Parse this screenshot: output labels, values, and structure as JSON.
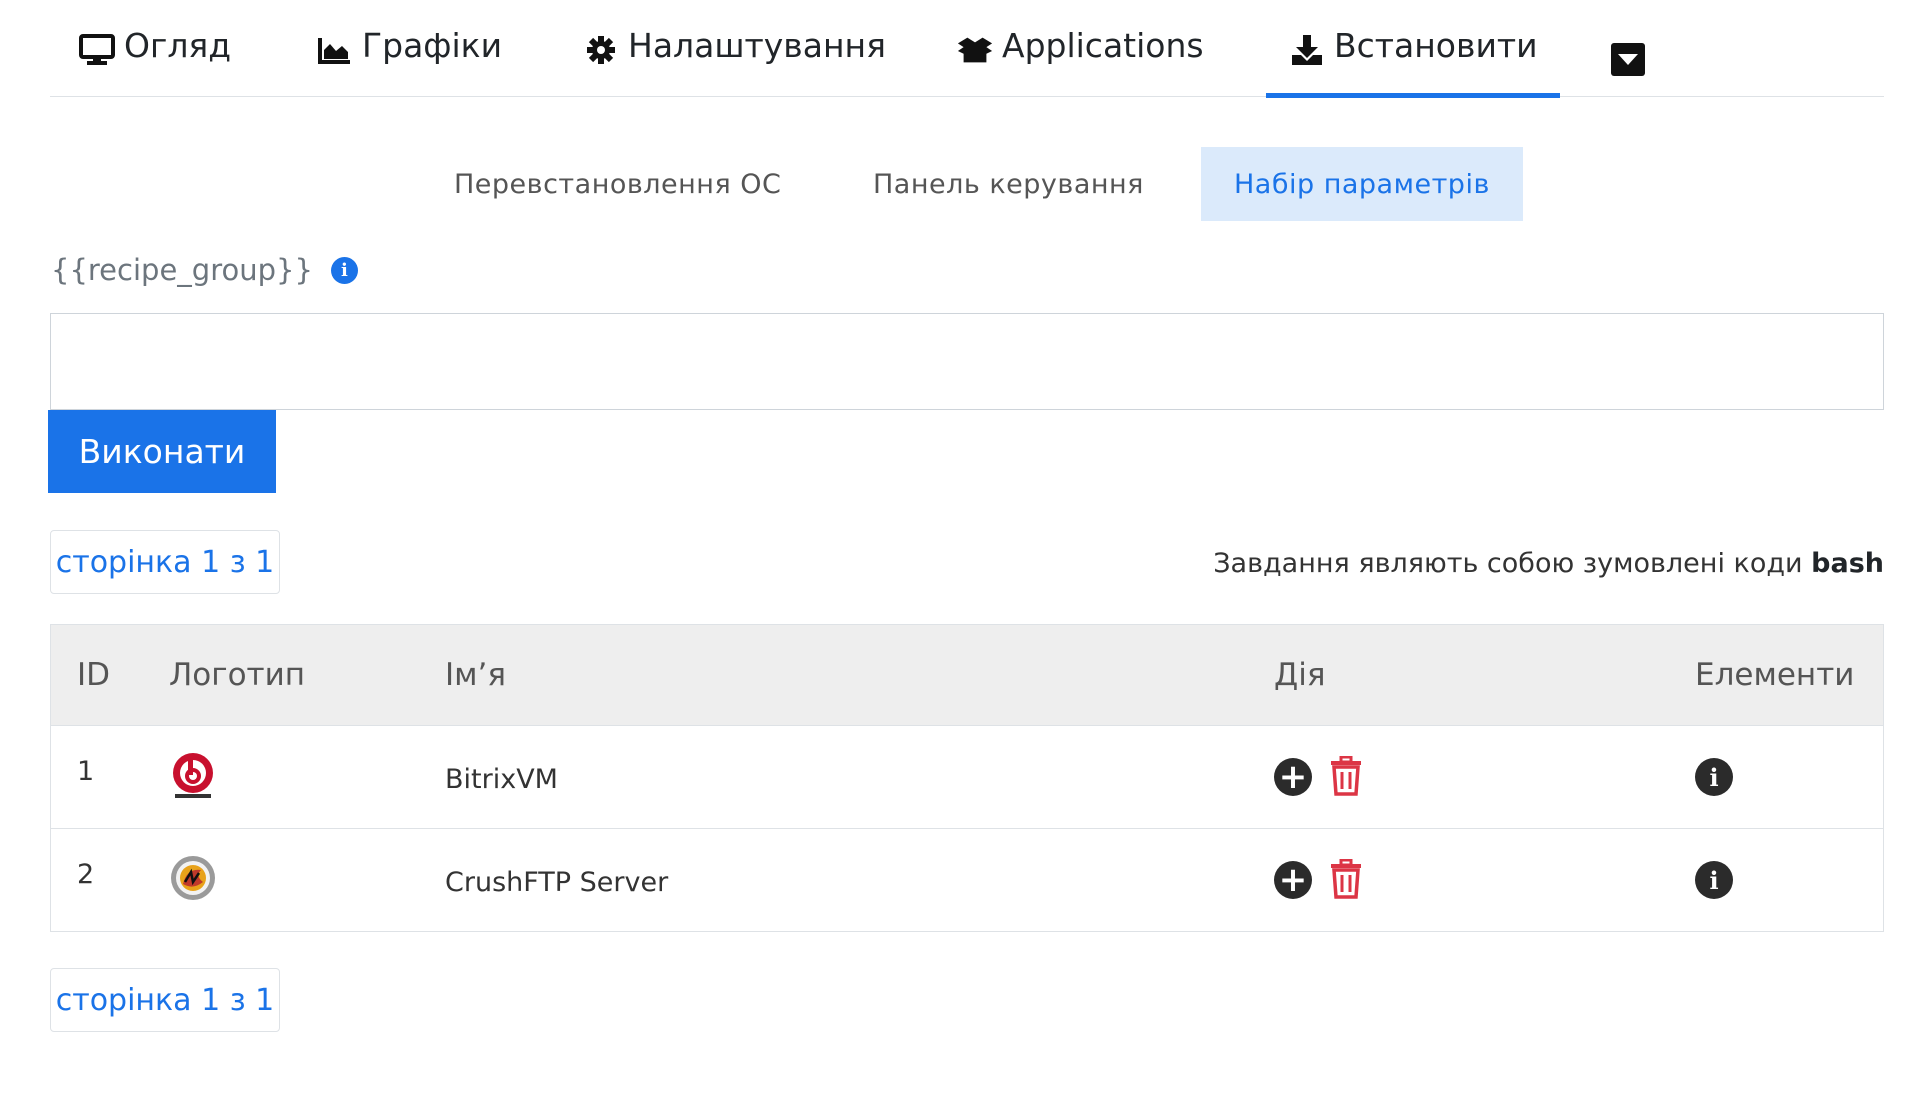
{
  "top_tabs": [
    {
      "label": "Огляд",
      "icon": "monitor-icon"
    },
    {
      "label": "Графіки",
      "icon": "area-chart-icon"
    },
    {
      "label": "Налаштування",
      "icon": "gear-icon"
    },
    {
      "label": "Applications",
      "icon": "box-open-icon"
    },
    {
      "label": "Встановити",
      "icon": "download-icon",
      "active": true
    }
  ],
  "sub_tabs": [
    {
      "label": "Перевстановлення ОС"
    },
    {
      "label": "Панель керування"
    },
    {
      "label": "Набір параметрів",
      "active": true
    }
  ],
  "recipe": {
    "label": "{{recipe_group}}",
    "info_glyph": "i",
    "command_value": ""
  },
  "run_button": "Виконати",
  "pager_label": "сторінка 1 з 1",
  "note": {
    "text": "Завдання являють собою зумовлені коди ",
    "bold": "bash"
  },
  "table": {
    "headers": [
      "ID",
      "Логотип",
      "Ім’я",
      "Дія",
      "Елементи"
    ],
    "rows": [
      {
        "id": "1",
        "name": "BitrixVM",
        "logo": "bitrix-logo"
      },
      {
        "id": "2",
        "name": "CrushFTP Server",
        "logo": "crushftp-logo"
      }
    ]
  },
  "colors": {
    "accent": "#1a73e8",
    "active_subtab_bg": "#dbeafb",
    "danger": "#dc3545",
    "header_bg": "#eeeeee"
  }
}
